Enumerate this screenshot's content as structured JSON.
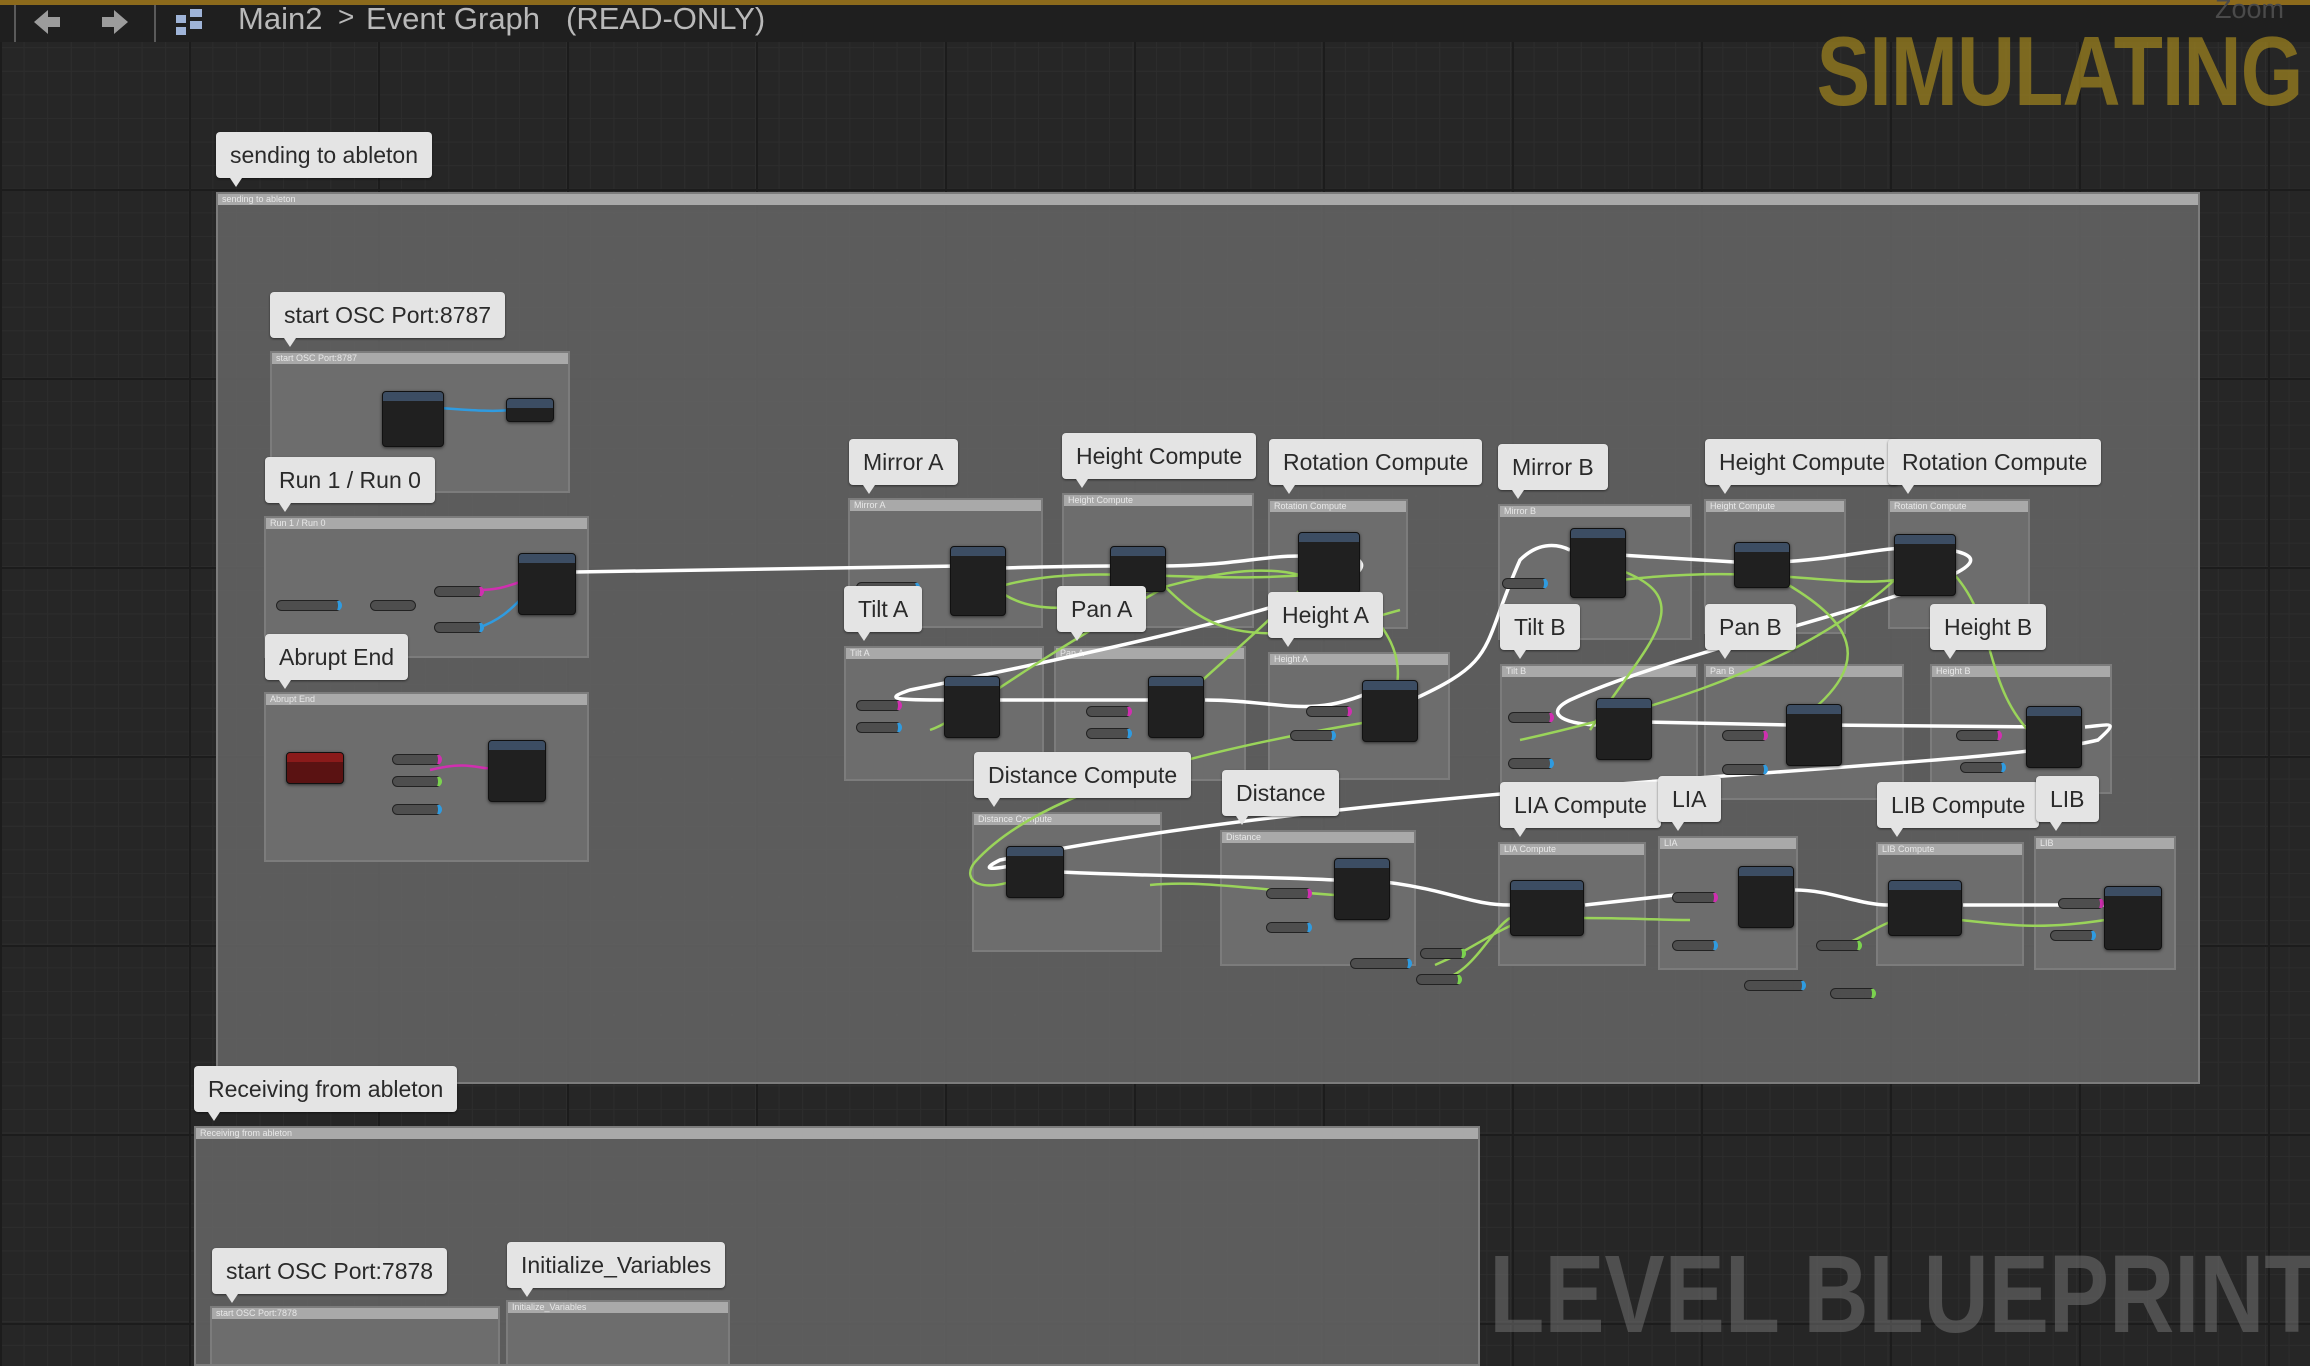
{
  "breadcrumb": {
    "root": "Main2",
    "separator": ">",
    "graph": "Event Graph",
    "mode": "(READ-ONLY)"
  },
  "icons": {
    "back": "back-arrow-icon",
    "forward": "forward-arrow-icon",
    "graph": "graph-grid-icon"
  },
  "overlay": {
    "simulating": "SIMULATING",
    "zoom": "Zoom",
    "level_blueprint": "LEVEL BLUEPRINT"
  },
  "colors": {
    "simulating": "#a0841e",
    "exec_wire": "#ffffff",
    "float_wire": "#9ad45a",
    "string_pin": "#d02fb0",
    "object_pin": "#2f9be0",
    "comment_fill": "#707070",
    "bubble": "#e4e4e4"
  },
  "comments": {
    "sending": "sending to ableton",
    "start_osc_8787": "start OSC Port:8787",
    "run": "Run 1 / Run 0",
    "abrupt_end": "Abrupt End",
    "mirror_a": "Mirror A",
    "height_compute_a": "Height Compute",
    "rotation_compute_a": "Rotation Compute",
    "mirror_b": "Mirror B",
    "height_compute_b": "Height Compute",
    "rotation_compute_b": "Rotation Compute",
    "tilt_a": "Tilt A",
    "pan_a": "Pan A",
    "height_a": "Height A",
    "tilt_b": "Tilt B",
    "pan_b": "Pan B",
    "height_b": "Height B",
    "distance_compute": "Distance Compute",
    "distance": "Distance",
    "lia_compute": "LIA Compute",
    "lia": "LIA",
    "lib_compute": "LIB Compute",
    "lib": "LIB",
    "receiving": "Receiving from ableton",
    "start_osc_7878": "start OSC Port:7878",
    "initialize_variables": "Initialize_Variables"
  },
  "comment_headers": {
    "sending": "sending to ableton",
    "start_osc_8787": "start OSC Port:8787",
    "run": "Run 1 / Run 0",
    "abrupt_end": "Abrupt End",
    "mirror_a": "Mirror A",
    "height_compute_a": "Height Compute",
    "rotation_compute_a": "Rotation Compute",
    "mirror_b": "Mirror B",
    "height_compute_b": "Height Compute",
    "rotation_compute_b": "Rotation Compute",
    "tilt_a": "Tilt A",
    "pan_a": "Pan A",
    "height_a": "Height A",
    "tilt_b": "Tilt B",
    "pan_b": "Pan B",
    "height_b": "Height B",
    "distance_compute": "Distance Compute",
    "distance": "Distance",
    "lia_compute": "LIA Compute",
    "lia": "LIA",
    "lib_compute": "LIB Compute",
    "lib": "LIB",
    "receiving": "Receiving from ableton",
    "start_osc_7878": "start OSC Port:7878",
    "initialize_variables": "Initialize_Variables"
  }
}
